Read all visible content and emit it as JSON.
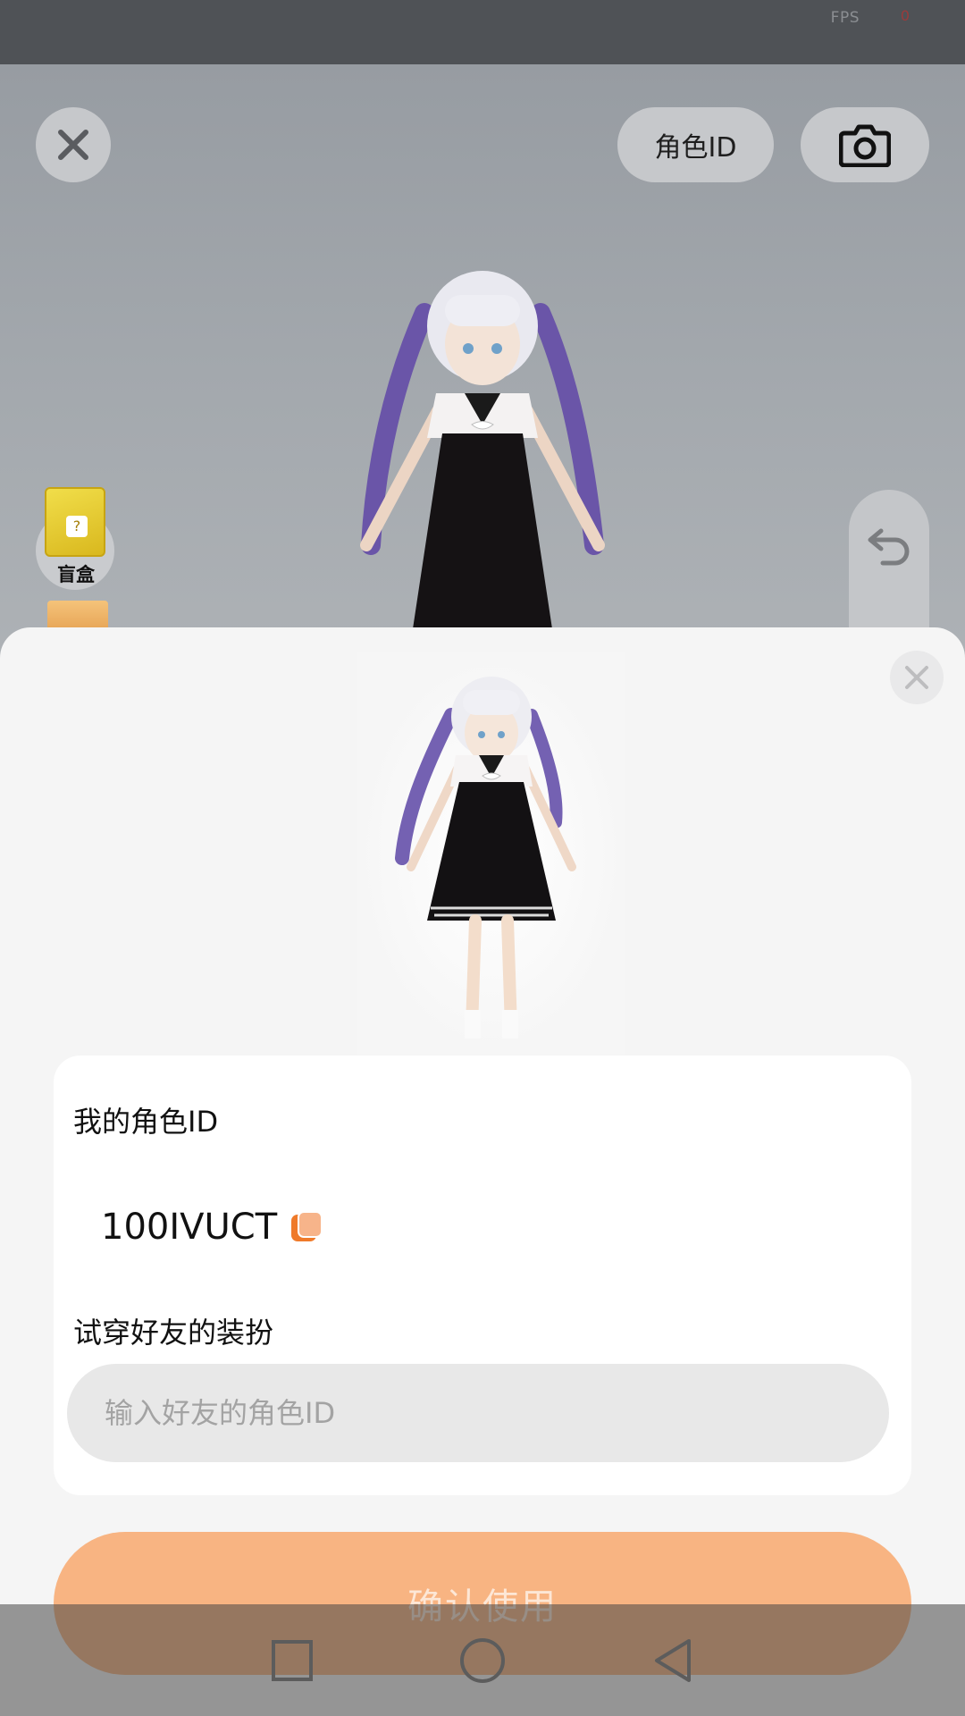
{
  "status_bar": {
    "fps_label": "FPS",
    "fps_value": "0"
  },
  "top_bar": {
    "close_icon": "close-icon",
    "role_id_button": "角色ID",
    "camera_icon": "camera-icon"
  },
  "side_items": {
    "blind_box_label": "盲盒"
  },
  "sheet": {
    "close_icon": "close-icon",
    "my_role_id_title": "我的角色ID",
    "my_role_id_value": "100IVUCT",
    "copy_icon": "copy-icon",
    "try_friend_title": "试穿好友的装扮",
    "friend_input_placeholder": "输入好友的角色ID",
    "friend_input_value": "",
    "confirm_button": "确认使用"
  },
  "nav_bar": {
    "recent_icon": "square-icon",
    "home_icon": "circle-icon",
    "back_icon": "triangle-back-icon"
  },
  "colors": {
    "accent": "#f8b482",
    "copy_accent": "#ef7a2a",
    "sheet_bg": "#f5f5f5",
    "card_bg": "#ffffff",
    "input_bg": "#e8e8e8"
  }
}
